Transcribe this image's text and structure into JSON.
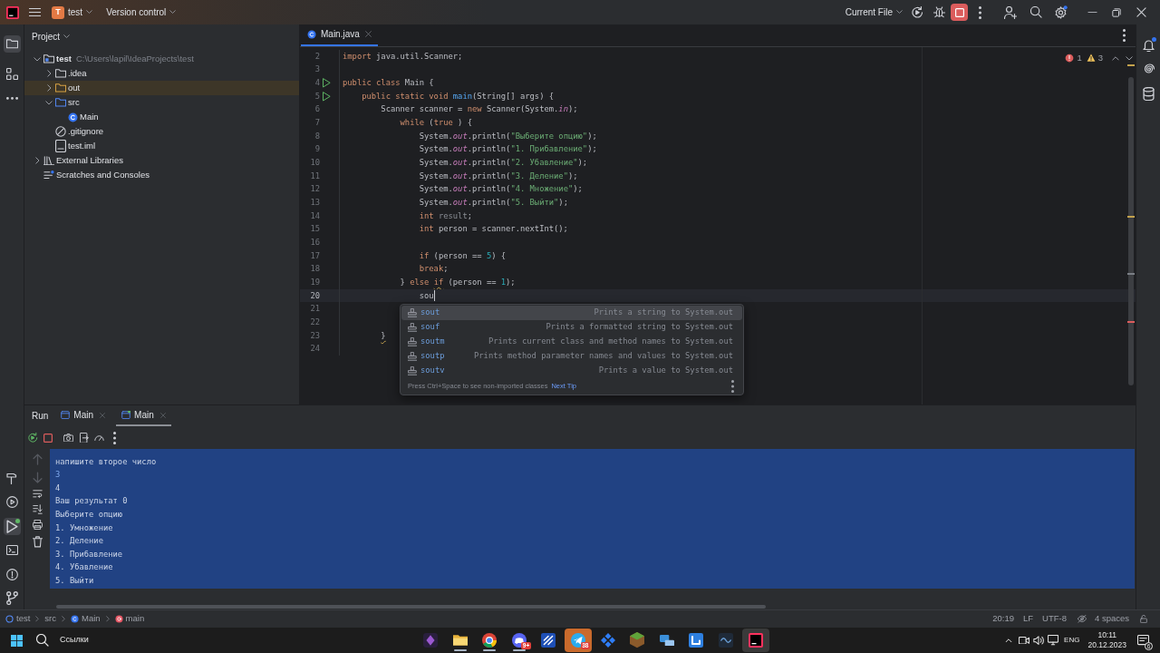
{
  "title_bar": {
    "project_badge": "T",
    "project": "test",
    "vcs": "Version control",
    "run_config": "Current File",
    "settings_indicator": true
  },
  "tool_strip_left": {
    "top": [
      {
        "kind": "project",
        "selected": true,
        "indicator": false
      },
      {
        "kind": "structure",
        "selected": false,
        "indicator": false
      },
      {
        "kind": "more",
        "selected": false,
        "indicator": false
      }
    ],
    "bottom": [
      {
        "kind": "build",
        "selected": false,
        "indicator": false
      },
      {
        "kind": "services",
        "selected": false,
        "indicator": false
      },
      {
        "kind": "run",
        "selected": true,
        "indicator": true
      },
      {
        "kind": "terminal",
        "selected": false,
        "indicator": false
      },
      {
        "kind": "problems",
        "selected": false,
        "indicator": false
      },
      {
        "kind": "git",
        "selected": false,
        "indicator": false
      }
    ]
  },
  "project_panel": {
    "title": "Project",
    "tree": [
      {
        "label": "test",
        "path": "C:\\Users\\lapil\\IdeaProjects\\test",
        "kind": "module",
        "expanded": true,
        "children": [
          {
            "label": ".idea",
            "kind": "folder",
            "expanded": false
          },
          {
            "label": "out",
            "kind": "excluded",
            "expanded": false
          },
          {
            "label": "src",
            "kind": "source",
            "expanded": true,
            "children": [
              {
                "label": "Main",
                "kind": "class"
              }
            ]
          },
          {
            "label": ".gitignore",
            "kind": "ignore"
          },
          {
            "label": "test.iml",
            "kind": "module-file"
          }
        ]
      },
      {
        "label": "External Libraries",
        "kind": "libraries",
        "expanded": false
      },
      {
        "label": "Scratches and Consoles",
        "kind": "scratches"
      }
    ]
  },
  "editor": {
    "tab": {
      "label": "Main.java",
      "selected": true
    },
    "problems": {
      "errors": "1",
      "warnings": "3"
    },
    "lines": [
      {
        "number": "2",
        "run": false,
        "current": false,
        "tokens": [
          {
            "kind": "keyword",
            "text": "import"
          },
          {
            "kind": "plain",
            "text": " java.util.Scanner;"
          }
        ]
      },
      {
        "number": "3",
        "run": false,
        "current": false
      },
      {
        "number": "4",
        "run": true,
        "current": false,
        "tokens": [
          {
            "kind": "keyword",
            "text": "public class"
          },
          {
            "kind": "plain",
            "text": " Main {"
          }
        ]
      },
      {
        "number": "5",
        "run": true,
        "current": false,
        "tokens": [
          {
            "kind": "keyword",
            "text": "    public static void "
          },
          {
            "kind": "method",
            "text": "main"
          },
          {
            "kind": "plain",
            "text": "(String[] args) {"
          }
        ]
      },
      {
        "number": "6",
        "run": false,
        "current": false,
        "tokens": [
          {
            "kind": "plain",
            "text": "        Scanner scanner = "
          },
          {
            "kind": "keyword",
            "text": "new"
          },
          {
            "kind": "plain",
            "text": " Scanner(System."
          },
          {
            "kind": "field",
            "text": "in"
          },
          {
            "kind": "plain",
            "text": ");"
          }
        ]
      },
      {
        "number": "7",
        "run": false,
        "current": false,
        "tokens": [
          {
            "kind": "keyword",
            "text": "            while"
          },
          {
            "kind": "plain",
            "text": " ("
          },
          {
            "kind": "keyword",
            "text": "true"
          },
          {
            "kind": "plain",
            "text": " ) {"
          }
        ]
      },
      {
        "number": "8",
        "run": false,
        "current": false,
        "tokens": [
          {
            "kind": "plain",
            "text": "                System."
          },
          {
            "kind": "field",
            "text": "out"
          },
          {
            "kind": "plain",
            "text": ".println("
          },
          {
            "kind": "string",
            "text": "\"Выберите опцию\""
          },
          {
            "kind": "plain",
            "text": ");"
          }
        ]
      },
      {
        "number": "9",
        "run": false,
        "current": false,
        "tokens": [
          {
            "kind": "plain",
            "text": "                System."
          },
          {
            "kind": "field",
            "text": "out"
          },
          {
            "kind": "plain",
            "text": ".println("
          },
          {
            "kind": "string",
            "text": "\"1. Прибавление\""
          },
          {
            "kind": "plain",
            "text": ");"
          }
        ]
      },
      {
        "number": "10",
        "run": false,
        "current": false,
        "tokens": [
          {
            "kind": "plain",
            "text": "                System."
          },
          {
            "kind": "field",
            "text": "out"
          },
          {
            "kind": "plain",
            "text": ".println("
          },
          {
            "kind": "string",
            "text": "\"2. Убавление\""
          },
          {
            "kind": "plain",
            "text": ");"
          }
        ]
      },
      {
        "number": "11",
        "run": false,
        "current": false,
        "tokens": [
          {
            "kind": "plain",
            "text": "                System."
          },
          {
            "kind": "field",
            "text": "out"
          },
          {
            "kind": "plain",
            "text": ".println("
          },
          {
            "kind": "string",
            "text": "\"3. Деление\""
          },
          {
            "kind": "plain",
            "text": ");"
          }
        ]
      },
      {
        "number": "12",
        "run": false,
        "current": false,
        "tokens": [
          {
            "kind": "plain",
            "text": "                System."
          },
          {
            "kind": "field",
            "text": "out"
          },
          {
            "kind": "plain",
            "text": ".println("
          },
          {
            "kind": "string",
            "text": "\"4. Множение\""
          },
          {
            "kind": "plain",
            "text": ");"
          }
        ]
      },
      {
        "number": "13",
        "run": false,
        "current": false,
        "tokens": [
          {
            "kind": "plain",
            "text": "                System."
          },
          {
            "kind": "field",
            "text": "out"
          },
          {
            "kind": "plain",
            "text": ".println("
          },
          {
            "kind": "string",
            "text": "\"5. Выйти\""
          },
          {
            "kind": "plain",
            "text": ");"
          }
        ]
      },
      {
        "number": "14",
        "run": false,
        "current": false,
        "tokens": [
          {
            "kind": "keyword",
            "text": "                int "
          },
          {
            "kind": "unused",
            "text": "result"
          },
          {
            "kind": "plain",
            "text": ";"
          }
        ]
      },
      {
        "number": "15",
        "run": false,
        "current": false,
        "tokens": [
          {
            "kind": "keyword",
            "text": "                int"
          },
          {
            "kind": "plain",
            "text": " person = scanner.nextInt();"
          }
        ]
      },
      {
        "number": "16",
        "run": false,
        "current": false
      },
      {
        "number": "17",
        "run": false,
        "current": false,
        "tokens": [
          {
            "kind": "keyword",
            "text": "                if"
          },
          {
            "kind": "plain",
            "text": " (person == "
          },
          {
            "kind": "number",
            "text": "5"
          },
          {
            "kind": "plain",
            "text": ") {"
          }
        ]
      },
      {
        "number": "18",
        "run": false,
        "current": false,
        "tokens": [
          {
            "kind": "keyword",
            "text": "                break"
          },
          {
            "kind": "plain",
            "text": ";"
          }
        ]
      },
      {
        "number": "19",
        "run": false,
        "current": false,
        "tokens": [
          {
            "kind": "plain",
            "text": "            } "
          },
          {
            "kind": "keyword",
            "text": "else "
          },
          {
            "kind": "keyword",
            "text": "if",
            "warning": true
          },
          {
            "kind": "plain",
            "text": " (person == "
          },
          {
            "kind": "number",
            "text": "1"
          },
          {
            "kind": "plain",
            "text": ");"
          }
        ]
      },
      {
        "number": "20",
        "run": false,
        "current": true,
        "tokens": [
          {
            "kind": "plain",
            "text": "                sou"
          }
        ]
      },
      {
        "number": "21",
        "run": false,
        "current": false
      },
      {
        "number": "22",
        "run": false,
        "current": false
      },
      {
        "number": "23",
        "run": false,
        "current": false,
        "tokens": [
          {
            "kind": "plain",
            "text": "        }",
            "warning": true
          }
        ]
      },
      {
        "number": "24",
        "run": false,
        "current": false
      }
    ],
    "completion": {
      "items": [
        {
          "name": "sout",
          "description": "Prints a string to System.out",
          "selected": true
        },
        {
          "name": "souf",
          "description": "Prints a formatted string to System.out",
          "selected": false
        },
        {
          "name": "soutm",
          "description": "Prints current class and method names to System.out",
          "selected": false
        },
        {
          "name": "soutp",
          "description": "Prints method parameter names and values to System.out",
          "selected": false
        },
        {
          "name": "soutv",
          "description": "Prints a value to System.out",
          "selected": false
        }
      ],
      "hint": "Press Ctrl+Space to see non-imported classes",
      "link": "Next Tip"
    }
  },
  "tool_strip_right": [
    {
      "kind": "notifications",
      "selected": false,
      "indicator": true
    },
    {
      "kind": "assistant",
      "selected": false,
      "indicator": false
    },
    {
      "kind": "database",
      "selected": false,
      "indicator": false
    }
  ],
  "run_panel": {
    "title": "Run",
    "tabs": [
      {
        "label": "Main",
        "selected": false,
        "running": false
      },
      {
        "label": "Main",
        "selected": true,
        "running": true
      }
    ],
    "console_toolbar": [
      {
        "kind": "up",
        "disabled": true
      },
      {
        "kind": "down",
        "disabled": true
      },
      {
        "kind": "wrap",
        "disabled": false
      },
      {
        "kind": "scroll_end",
        "disabled": false
      },
      {
        "kind": "print",
        "disabled": false
      },
      {
        "kind": "clear",
        "disabled": false
      }
    ],
    "console": {
      "all_selected": true,
      "lines": [
        {
          "text": "напишите второе число",
          "kind": "output"
        },
        {
          "text": "3",
          "kind": "input"
        },
        {
          "text": "4",
          "kind": "output"
        },
        {
          "text": "Ваш результат 0",
          "kind": "output"
        },
        {
          "text": "Выберите опцию",
          "kind": "output"
        },
        {
          "text": "1. Умножение",
          "kind": "output"
        },
        {
          "text": "2. Деление",
          "kind": "output"
        },
        {
          "text": "3. Прибавление",
          "kind": "output"
        },
        {
          "text": "4. Убавление",
          "kind": "output"
        },
        {
          "text": "5. Выйти",
          "kind": "output"
        }
      ]
    }
  },
  "status_bar": {
    "breadcrumbs": [
      {
        "label": "test",
        "kind": "module"
      },
      {
        "label": "src",
        "kind": "folder"
      },
      {
        "label": "Main",
        "kind": "class"
      },
      {
        "label": "main",
        "kind": "method"
      }
    ],
    "position": "20:19",
    "line_separator": "LF",
    "encoding": "UTF-8",
    "indent": "4 spaces"
  },
  "taskbar": {
    "search_label": "Ссылки",
    "apps": [
      {
        "kind": "notes",
        "running": false,
        "active": false,
        "attention": false
      },
      {
        "kind": "files",
        "running": true,
        "active": false,
        "attention": false
      },
      {
        "kind": "browser",
        "running": true,
        "active": false,
        "attention": false
      },
      {
        "kind": "chat",
        "running": true,
        "active": false,
        "attention": false,
        "badge": "9+"
      },
      {
        "kind": "tiles",
        "running": false,
        "active": false,
        "attention": false
      },
      {
        "kind": "messenger",
        "running": false,
        "active": false,
        "attention": true,
        "badge": "38"
      },
      {
        "kind": "grid",
        "running": false,
        "active": false,
        "attention": false
      },
      {
        "kind": "game",
        "running": false,
        "active": false,
        "attention": false
      },
      {
        "kind": "network",
        "running": false,
        "active": false,
        "attention": false
      },
      {
        "kind": "frame",
        "running": false,
        "active": false,
        "attention": false
      },
      {
        "kind": "writer",
        "running": false,
        "active": false,
        "attention": false
      },
      {
        "kind": "ide",
        "running": false,
        "active": true,
        "attention": false
      }
    ],
    "language": "ENG",
    "time": "10:11",
    "date": "20.12.2023",
    "notification_count": "6"
  }
}
